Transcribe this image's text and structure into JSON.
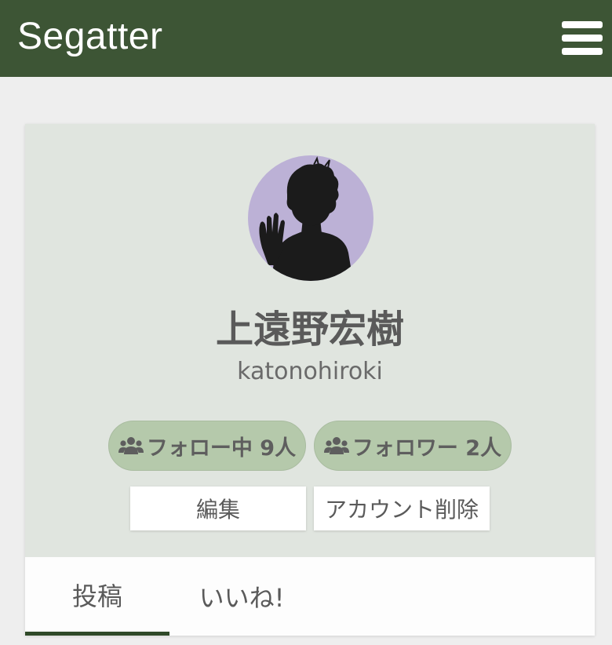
{
  "header": {
    "brand": "Segatter",
    "menu_icon": "hamburger-menu-icon",
    "background": "#3d5535"
  },
  "profile": {
    "display_name": "上遠野宏樹",
    "username": "katonohiroki",
    "avatar": "user-avatar-silhouette",
    "following_label": "フォロー中 9人",
    "followers_label": "フォロワー 2人",
    "users_icon": "users-icon",
    "edit_label": "編集",
    "delete_account_label": "アカウント削除"
  },
  "tabs": [
    {
      "label": "投稿",
      "active": true
    },
    {
      "label": "いいね!",
      "active": false
    }
  ],
  "colors": {
    "card_background": "#e0e5df",
    "pill_background": "#b5c9ab",
    "avatar_background": "#bcb1d6",
    "tab_active_indicator": "#2f4a28"
  }
}
